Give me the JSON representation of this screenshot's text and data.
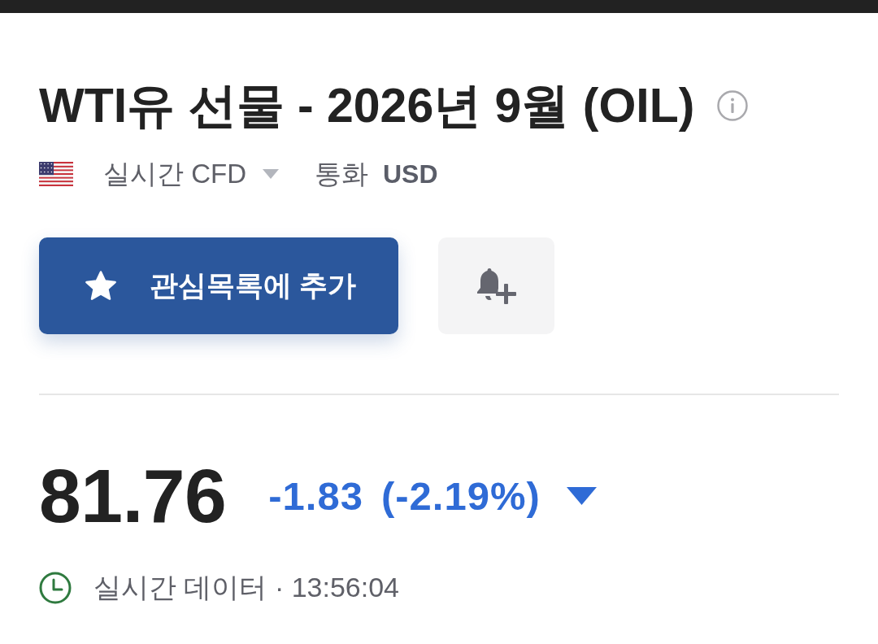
{
  "title": "WTI유 선물 - 2026년 9월 (OIL)",
  "meta": {
    "market": "실시간 CFD",
    "currency_label": "통화",
    "currency": "USD"
  },
  "actions": {
    "watchlist_button": "관심목록에 추가"
  },
  "quote": {
    "price": "81.76",
    "change": "-1.83",
    "change_percent": "(-2.19%)",
    "falling": true
  },
  "status": {
    "text": "실시간 데이터 · 13:56:04"
  }
}
